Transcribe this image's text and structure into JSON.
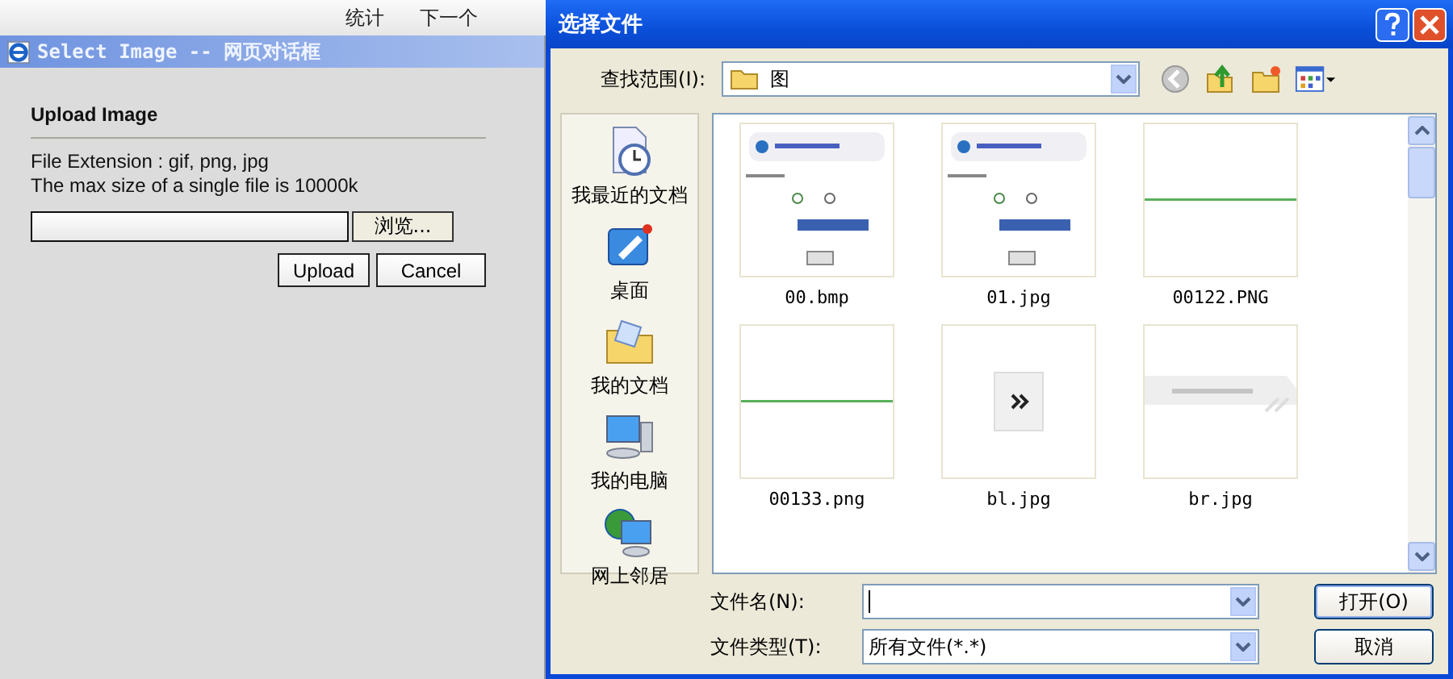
{
  "background_toolbar": {
    "items": [
      {
        "label": "统计"
      },
      {
        "label": "下一个"
      }
    ]
  },
  "web_dialog": {
    "title": "Select Image -- 网页对话框",
    "heading": "Upload Image",
    "lines": [
      "File Extension : gif, png, jpg",
      "The max size of a single file is 10000k"
    ],
    "browse_button": "浏览...",
    "buttons": [
      "Upload",
      "Cancel"
    ]
  },
  "file_dialog": {
    "title": "选择文件",
    "look_in_label": "查找范围(I):",
    "look_in_value": "图",
    "places": [
      {
        "label": "我最近的文档",
        "kind": "recent"
      },
      {
        "label": "桌面",
        "kind": "desktop"
      },
      {
        "label": "我的文档",
        "kind": "documents"
      },
      {
        "label": "我的电脑",
        "kind": "computer"
      },
      {
        "label": "网上邻居",
        "kind": "network"
      }
    ],
    "files": [
      {
        "name": "00.bmp",
        "kind": "form"
      },
      {
        "name": "01.jpg",
        "kind": "form"
      },
      {
        "name": "00122.PNG",
        "kind": "line"
      },
      {
        "name": "00133.png",
        "kind": "line"
      },
      {
        "name": "bl.jpg",
        "kind": "arrow"
      },
      {
        "name": "br.jpg",
        "kind": "banner"
      }
    ],
    "file_name_label": "文件名(N):",
    "file_type_label": "文件类型(T):",
    "file_type_value": "所有文件(*.*)",
    "buttons": [
      "打开(O)",
      "取消"
    ]
  }
}
